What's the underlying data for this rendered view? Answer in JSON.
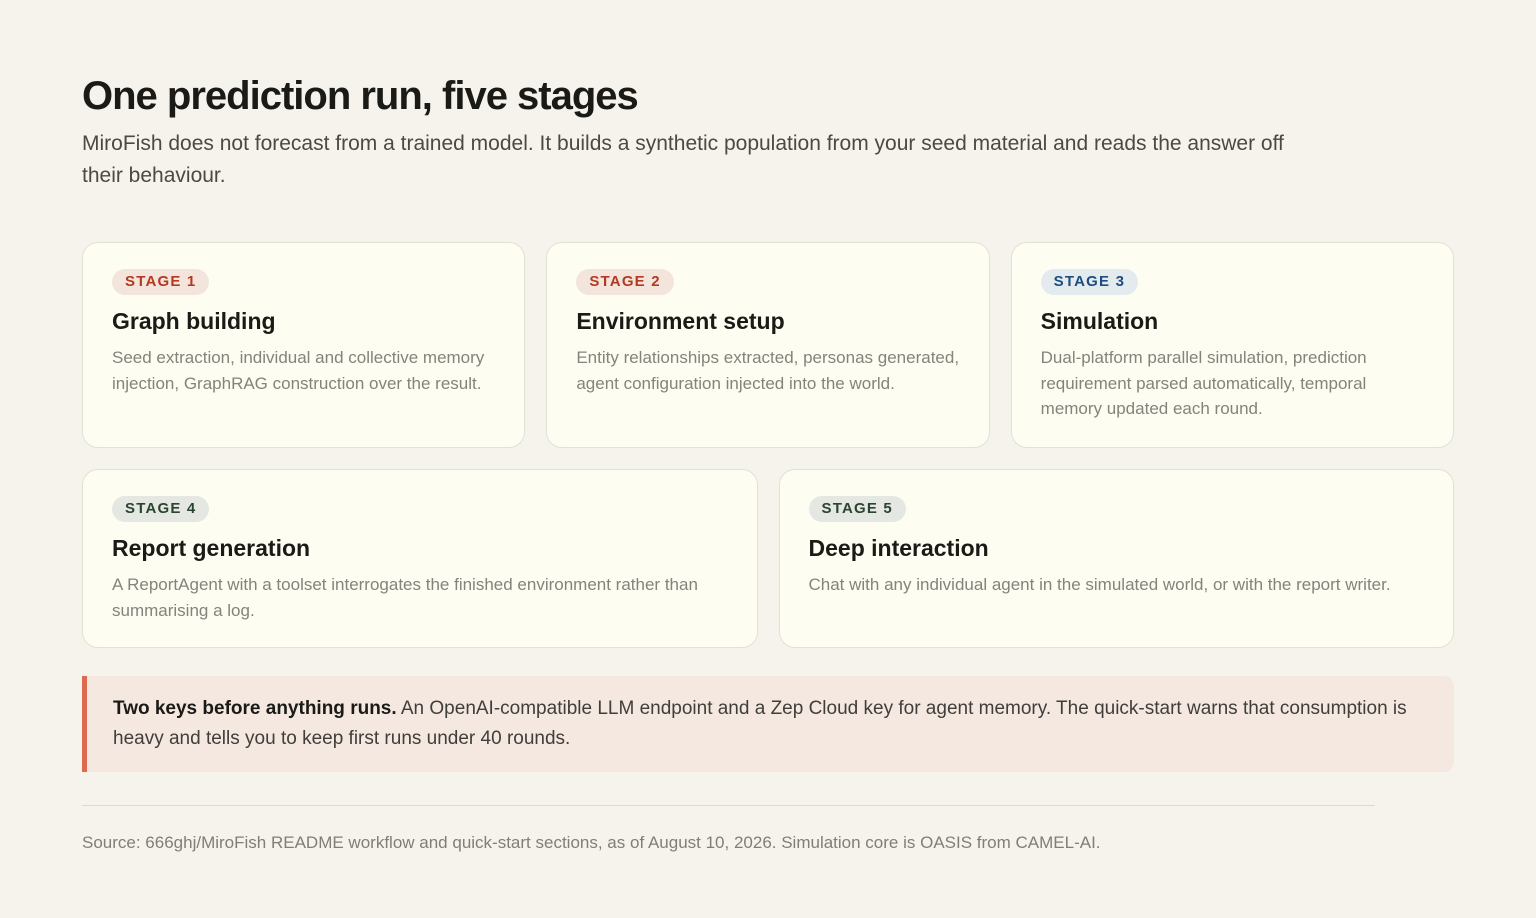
{
  "header": {
    "title": "One prediction run, five stages",
    "subtitle": "MiroFish does not forecast from a trained model. It builds a synthetic population from your seed material and reads the answer off their behaviour."
  },
  "stages": [
    {
      "badge": "STAGE 1",
      "title": "Graph building",
      "description": "Seed extraction, individual and collective memory injection, GraphRAG construction over the result."
    },
    {
      "badge": "STAGE 2",
      "title": "Environment setup",
      "description": "Entity relationships extracted, personas generated, agent configuration injected into the world."
    },
    {
      "badge": "STAGE 3",
      "title": "Simulation",
      "description": "Dual-platform parallel simulation, prediction requirement parsed automatically, temporal memory updated each round."
    },
    {
      "badge": "STAGE 4",
      "title": "Report generation",
      "description": "A ReportAgent with a toolset interrogates the finished environment rather than summarising a log."
    },
    {
      "badge": "STAGE 5",
      "title": "Deep interaction",
      "description": "Chat with any individual agent in the simulated world, or with the report writer."
    }
  ],
  "callout": {
    "lead": "Two keys before anything runs.",
    "body": " An OpenAI-compatible LLM endpoint and a Zep Cloud key for agent memory. The quick-start warns that consumption is heavy and tells you to keep first runs under 40 rounds."
  },
  "footer": {
    "source": "Source: 666ghj/MiroFish README workflow and quick-start sections, as of August 10, 2026. Simulation core is OASIS from CAMEL-AI."
  },
  "colors": {
    "background": "#f6f3ed",
    "card": "#fdfdf2",
    "accent_red": "#b23a22",
    "accent_blue": "#1e4d7e",
    "accent_green": "#2a4432",
    "callout_bar": "#dc6a4e"
  }
}
